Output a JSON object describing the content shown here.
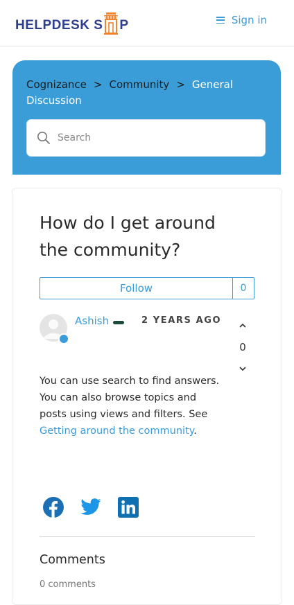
{
  "header": {
    "logo_part1": "HELPDESK S",
    "logo_part2": "P",
    "signin_label": "Sign in"
  },
  "breadcrumb": {
    "items": [
      "Cognizance",
      "Community",
      "General Discussion"
    ],
    "separator": ">"
  },
  "search": {
    "placeholder": "Search"
  },
  "post": {
    "title": "How do I get around the community?",
    "follow_label": "Follow",
    "follow_count": "0",
    "author": "Ashish",
    "time": "2 YEARS AGO",
    "votes": "0",
    "body_text": "You can use search to find answers. You can also browse topics and posts using views and filters. See ",
    "body_link": "Getting around the community",
    "body_end": "."
  },
  "share": [
    "facebook-icon",
    "twitter-icon",
    "linkedin-icon"
  ],
  "comments": {
    "heading": "Comments",
    "count": "0 comments"
  },
  "colors": {
    "accent": "#3a9bd8",
    "hero": "#3a9dd8",
    "logo": "#2e3e8f",
    "logo_orange": "#f0842c",
    "facebook": "#1d6fb3",
    "twitter": "#1d96e8",
    "linkedin": "#0f6fb0"
  }
}
